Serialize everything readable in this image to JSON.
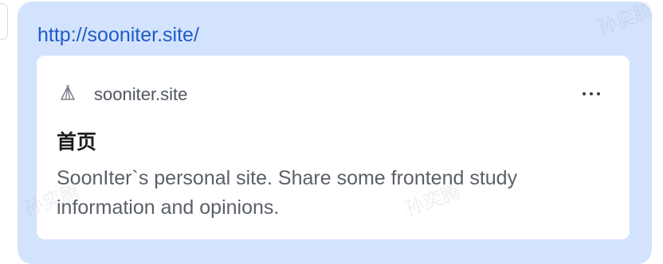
{
  "message": {
    "link_url": "http://sooniter.site/",
    "preview": {
      "site_icon": "tent-icon",
      "site_domain": "sooniter.site",
      "more_icon": "more-horizontal-icon",
      "title": "首页",
      "description": "SoonIter`s personal site. Share some frontend study information and opinions."
    }
  },
  "watermark": {
    "text": "孙奕腾"
  },
  "colors": {
    "bubble_background": "#d3e3fd",
    "link": "#1f5bc9",
    "card_background": "#ffffff"
  }
}
